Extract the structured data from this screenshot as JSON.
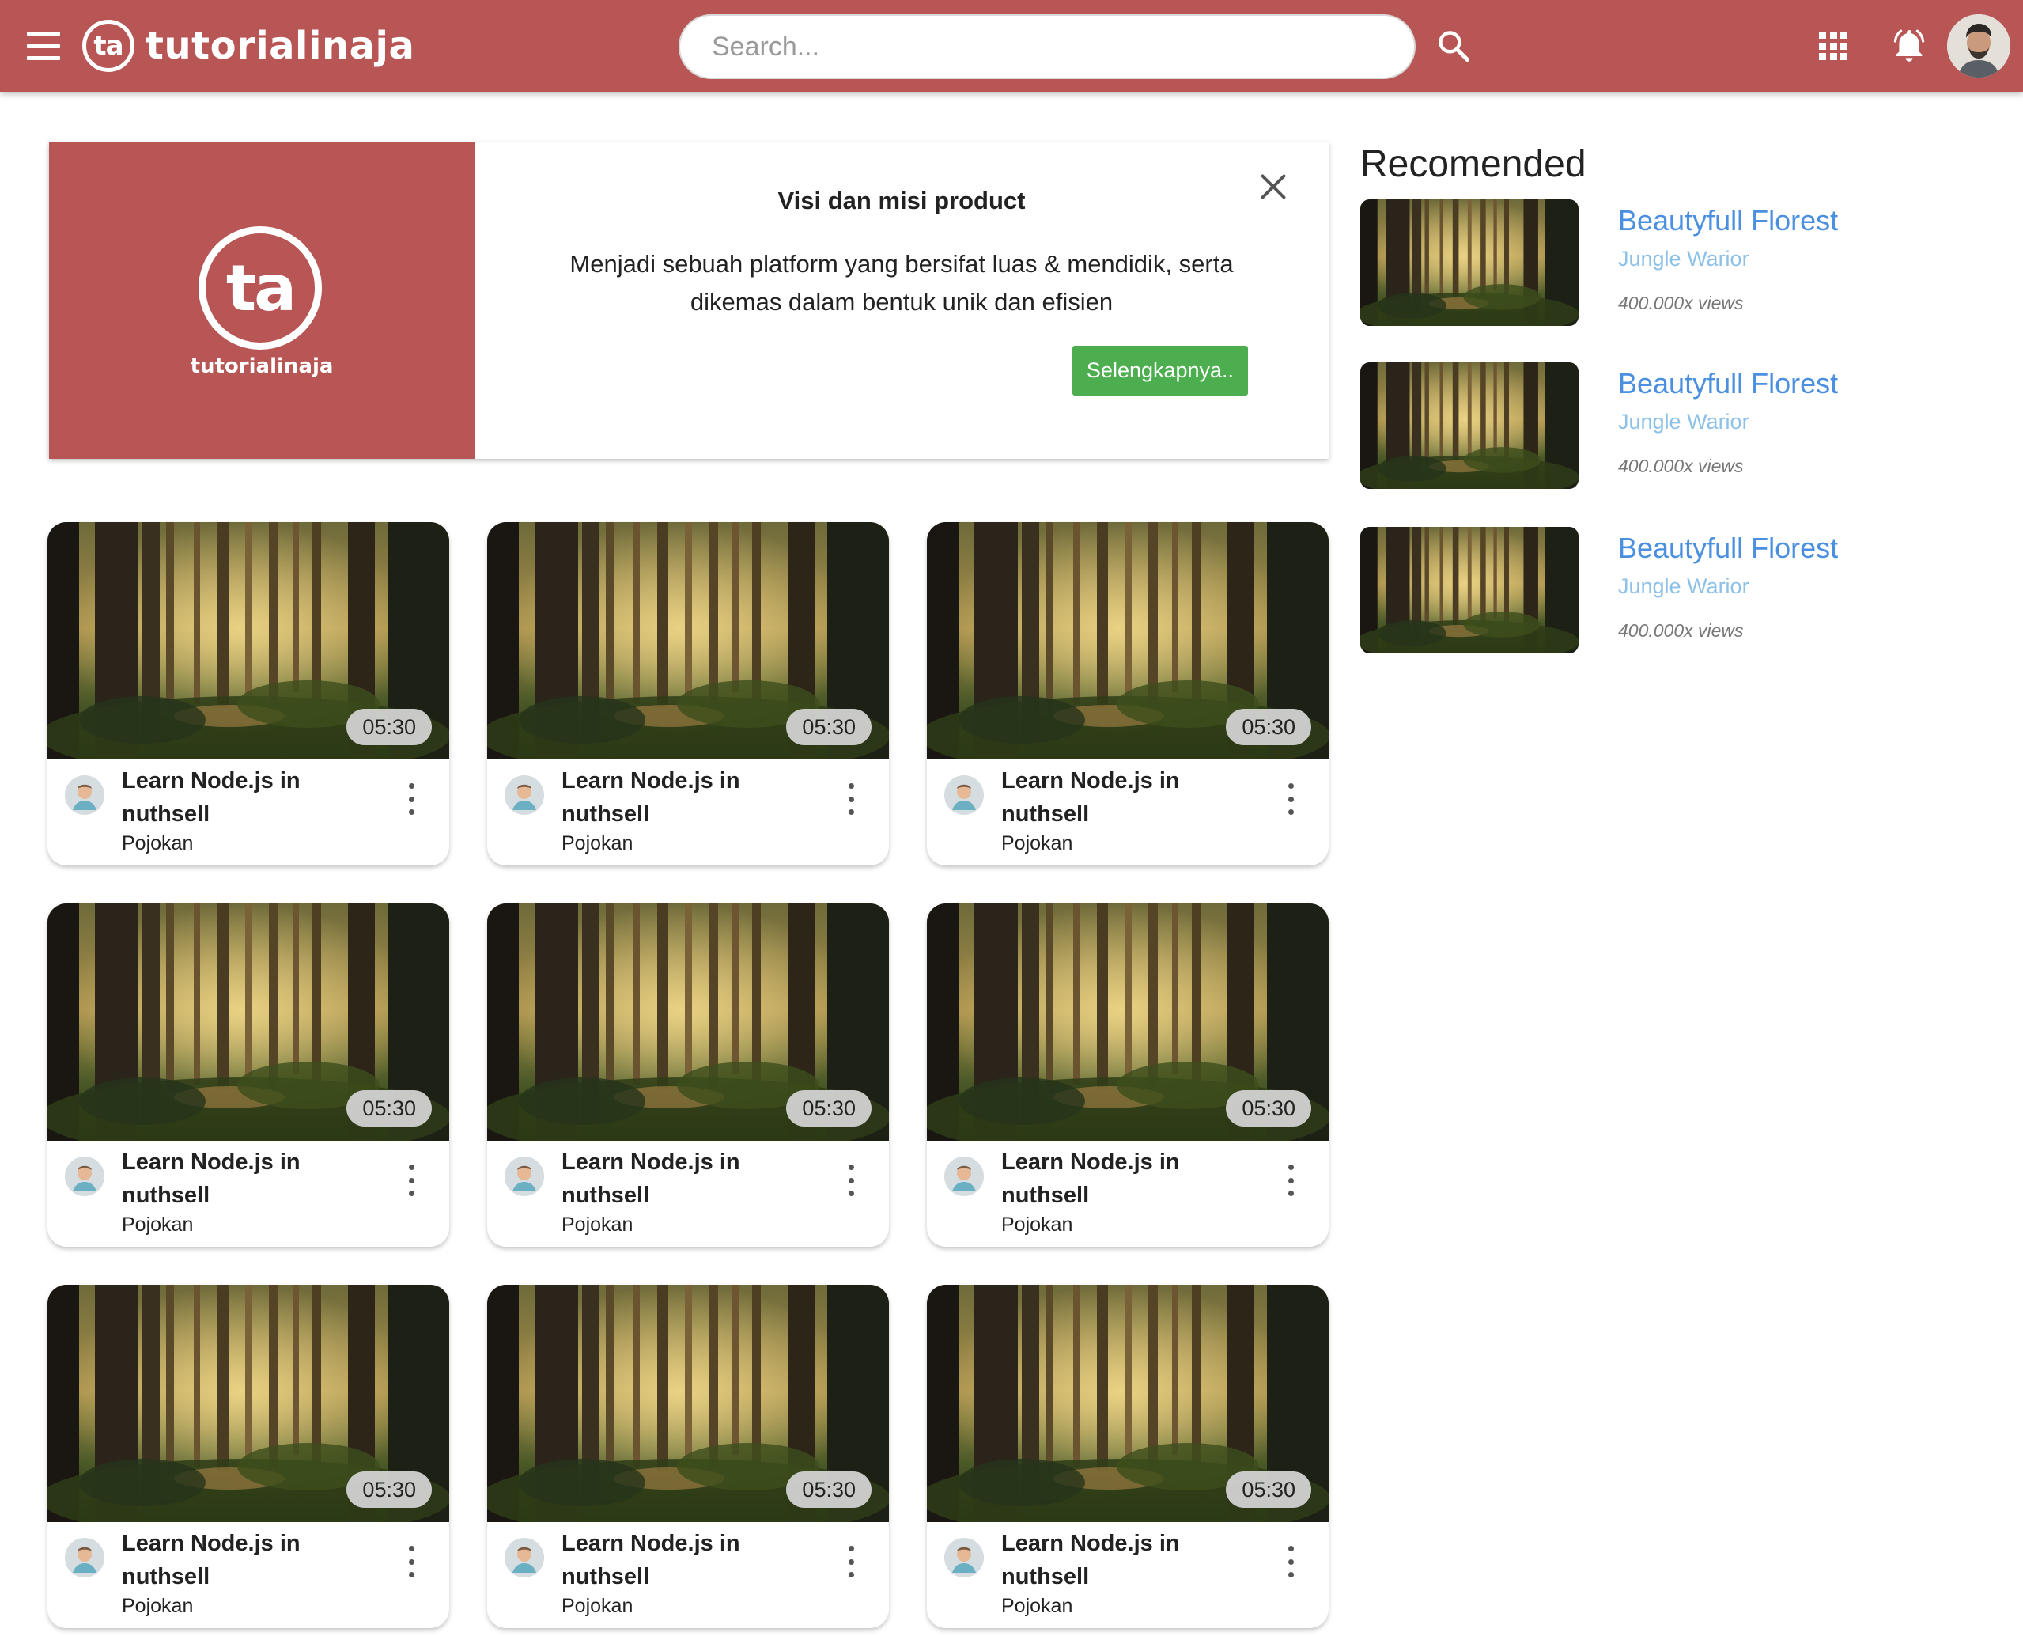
{
  "header": {
    "brand_mark": "ta",
    "brand_name": "tutorialinaja",
    "search_placeholder": "Search...",
    "icons": [
      "menu-icon",
      "search-icon",
      "apps-grid-icon",
      "bell-icon",
      "avatar"
    ],
    "bar_color": "#b85555"
  },
  "banner": {
    "logo_mark": "ta",
    "logo_name": "tutorialinaja",
    "title": "Visi dan misi product",
    "description_line1": "Menjadi sebuah platform yang bersifat luas & mendidik, serta",
    "description_line2": "dikemas dalam bentuk unik dan efisien",
    "button_label": "Selengkapnya..",
    "button_color": "#4cae4f"
  },
  "videos": [
    {
      "duration": "05:30",
      "title_line1": "Learn Node.js in",
      "title_line2": "nuthsell",
      "channel": "Pojokan"
    },
    {
      "duration": "05:30",
      "title_line1": "Learn Node.js in",
      "title_line2": "nuthsell",
      "channel": "Pojokan"
    },
    {
      "duration": "05:30",
      "title_line1": "Learn Node.js in",
      "title_line2": "nuthsell",
      "channel": "Pojokan"
    },
    {
      "duration": "05:30",
      "title_line1": "Learn Node.js in",
      "title_line2": "nuthsell",
      "channel": "Pojokan"
    },
    {
      "duration": "05:30",
      "title_line1": "Learn Node.js in",
      "title_line2": "nuthsell",
      "channel": "Pojokan"
    },
    {
      "duration": "05:30",
      "title_line1": "Learn Node.js in",
      "title_line2": "nuthsell",
      "channel": "Pojokan"
    },
    {
      "duration": "05:30",
      "title_line1": "Learn Node.js in",
      "title_line2": "nuthsell",
      "channel": "Pojokan"
    },
    {
      "duration": "05:30",
      "title_line1": "Learn Node.js in",
      "title_line2": "nuthsell",
      "channel": "Pojokan"
    },
    {
      "duration": "05:30",
      "title_line1": "Learn Node.js in",
      "title_line2": "nuthsell",
      "channel": "Pojokan"
    }
  ],
  "recommended": {
    "heading": "Recomended",
    "items": [
      {
        "title": "Beautyfull Florest",
        "subtitle": "Jungle Warior",
        "views": "400.000x views"
      },
      {
        "title": "Beautyfull Florest",
        "subtitle": "Jungle Warior",
        "views": "400.000x views"
      },
      {
        "title": "Beautyfull Florest",
        "subtitle": "Jungle Warior",
        "views": "400.000x views"
      }
    ]
  }
}
